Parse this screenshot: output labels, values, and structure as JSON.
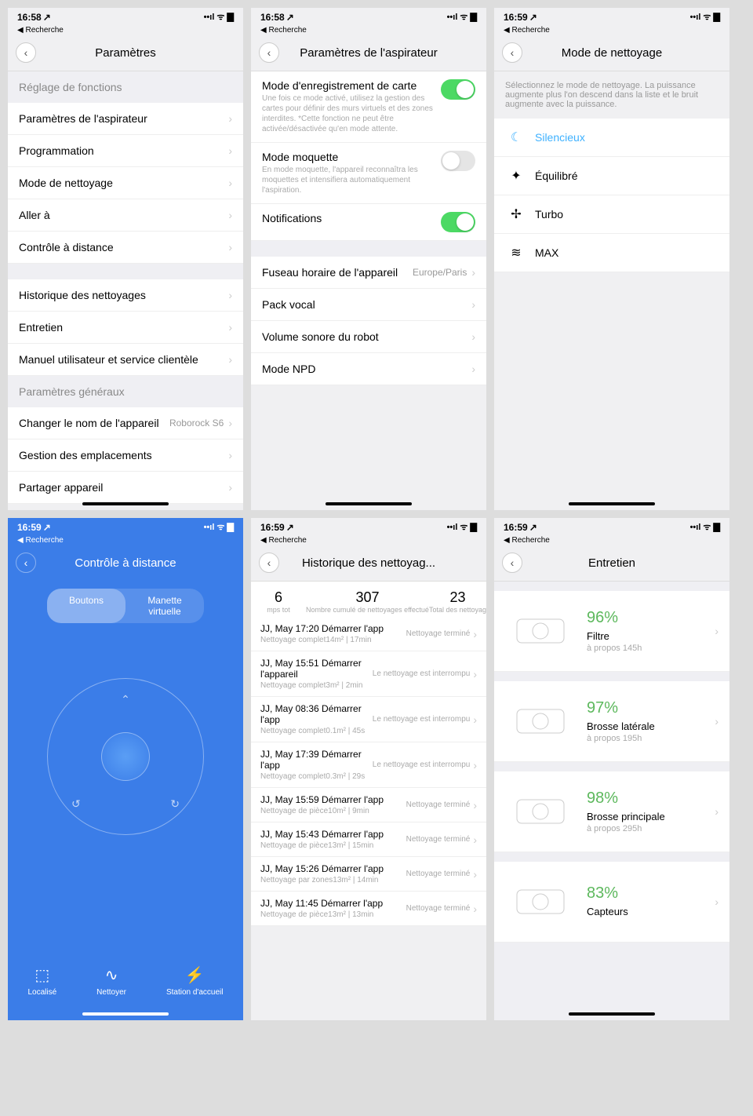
{
  "time1": "16:58",
  "time2": "16:59",
  "loc": "◀ Recherche",
  "s1": {
    "title": "Paramètres",
    "sec1": "Réglage de fonctions",
    "sec2": "Paramètres généraux",
    "items1": [
      "Paramètres de l'aspirateur",
      "Programmation",
      "Mode de nettoyage",
      "Aller à",
      "Contrôle à distance"
    ],
    "items2": [
      "Historique des nettoyages",
      "Entretien",
      "Manuel utilisateur et service clientèle"
    ],
    "items3": [
      {
        "l": "Changer le nom de l'appareil",
        "v": "Roborock S6"
      },
      {
        "l": "Gestion des emplacements",
        "v": ""
      },
      {
        "l": "Partager appareil",
        "v": ""
      }
    ]
  },
  "s2": {
    "title": "Paramètres de l'aspirateur",
    "t1": {
      "title": "Mode d'enregistrement de carte",
      "desc": "Une fois ce mode activé, utilisez la gestion des cartes pour définir des murs virtuels et des zones interdites. *Cette fonction ne peut être activée/désactivée qu'en mode attente.",
      "on": true
    },
    "t2": {
      "title": "Mode moquette",
      "desc": "En mode moquette, l'appareil reconnaîtra les moquettes et intensifiera automatiquement l'aspiration.",
      "on": false
    },
    "t3": {
      "title": "Notifications",
      "on": true
    },
    "rows": [
      {
        "l": "Fuseau horaire de l'appareil",
        "v": "Europe/Paris"
      },
      {
        "l": "Pack vocal",
        "v": ""
      },
      {
        "l": "Volume sonore du robot",
        "v": ""
      },
      {
        "l": "Mode NPD",
        "v": ""
      }
    ]
  },
  "s3": {
    "title": "Mode de nettoyage",
    "desc": "Sélectionnez le mode de nettoyage. La puissance augmente plus l'on descend dans la liste et le bruit augmente avec la puissance.",
    "modes": [
      {
        "i": "☾",
        "l": "Silencieux",
        "a": true
      },
      {
        "i": "✦",
        "l": "Équilibré"
      },
      {
        "i": "✢",
        "l": "Turbo"
      },
      {
        "i": "≋",
        "l": "MAX"
      }
    ]
  },
  "s4": {
    "title": "Contrôle à distance",
    "seg": [
      "Boutons",
      "Manette virtuelle"
    ],
    "nav": [
      {
        "i": "⬚",
        "l": "Localisé"
      },
      {
        "i": "∿",
        "l": "Nettoyer"
      },
      {
        "i": "⚡",
        "l": "Station d'accueil"
      }
    ]
  },
  "s5": {
    "title": "Historique des nettoyag...",
    "stats": [
      {
        "n": "6",
        "l": "mps tot"
      },
      {
        "n": "307",
        "l": "Nombre cumulé de nettoyages effectué"
      },
      {
        "n": "23",
        "l": "Total des nettoyag"
      }
    ],
    "rows": [
      {
        "d": "JJ, May 17:20 Démarrer l'app",
        "s": "Nettoyage complet14m² | 17min",
        "st": "Nettoyage terminé"
      },
      {
        "d": "JJ, May 15:51 Démarrer l'appareil",
        "s": "Nettoyage complet3m² | 2min",
        "st": "Le nettoyage est interrompu"
      },
      {
        "d": "JJ, May 08:36 Démarrer l'app",
        "s": "Nettoyage complet0.1m² | 45s",
        "st": "Le nettoyage est interrompu"
      },
      {
        "d": "JJ, May 17:39 Démarrer l'app",
        "s": "Nettoyage complet0.3m² | 29s",
        "st": "Le nettoyage est interrompu"
      },
      {
        "d": "JJ, May 15:59 Démarrer l'app",
        "s": "Nettoyage de pièce10m² | 9min",
        "st": "Nettoyage terminé"
      },
      {
        "d": "JJ, May 15:43 Démarrer l'app",
        "s": "Nettoyage de pièce13m² | 15min",
        "st": "Nettoyage terminé"
      },
      {
        "d": "JJ, May 15:26 Démarrer l'app",
        "s": "Nettoyage par zones13m² | 14min",
        "st": "Nettoyage terminé"
      },
      {
        "d": "JJ, May 11:45 Démarrer l'app",
        "s": "Nettoyage de pièce13m² | 13min",
        "st": "Nettoyage terminé"
      }
    ]
  },
  "s6": {
    "title": "Entretien",
    "items": [
      {
        "p": "96%",
        "n": "Filtre",
        "s": "à propos 145h"
      },
      {
        "p": "97%",
        "n": "Brosse latérale",
        "s": "à propos 195h"
      },
      {
        "p": "98%",
        "n": "Brosse principale",
        "s": "à propos 295h"
      },
      {
        "p": "83%",
        "n": "Capteurs",
        "s": ""
      }
    ]
  }
}
